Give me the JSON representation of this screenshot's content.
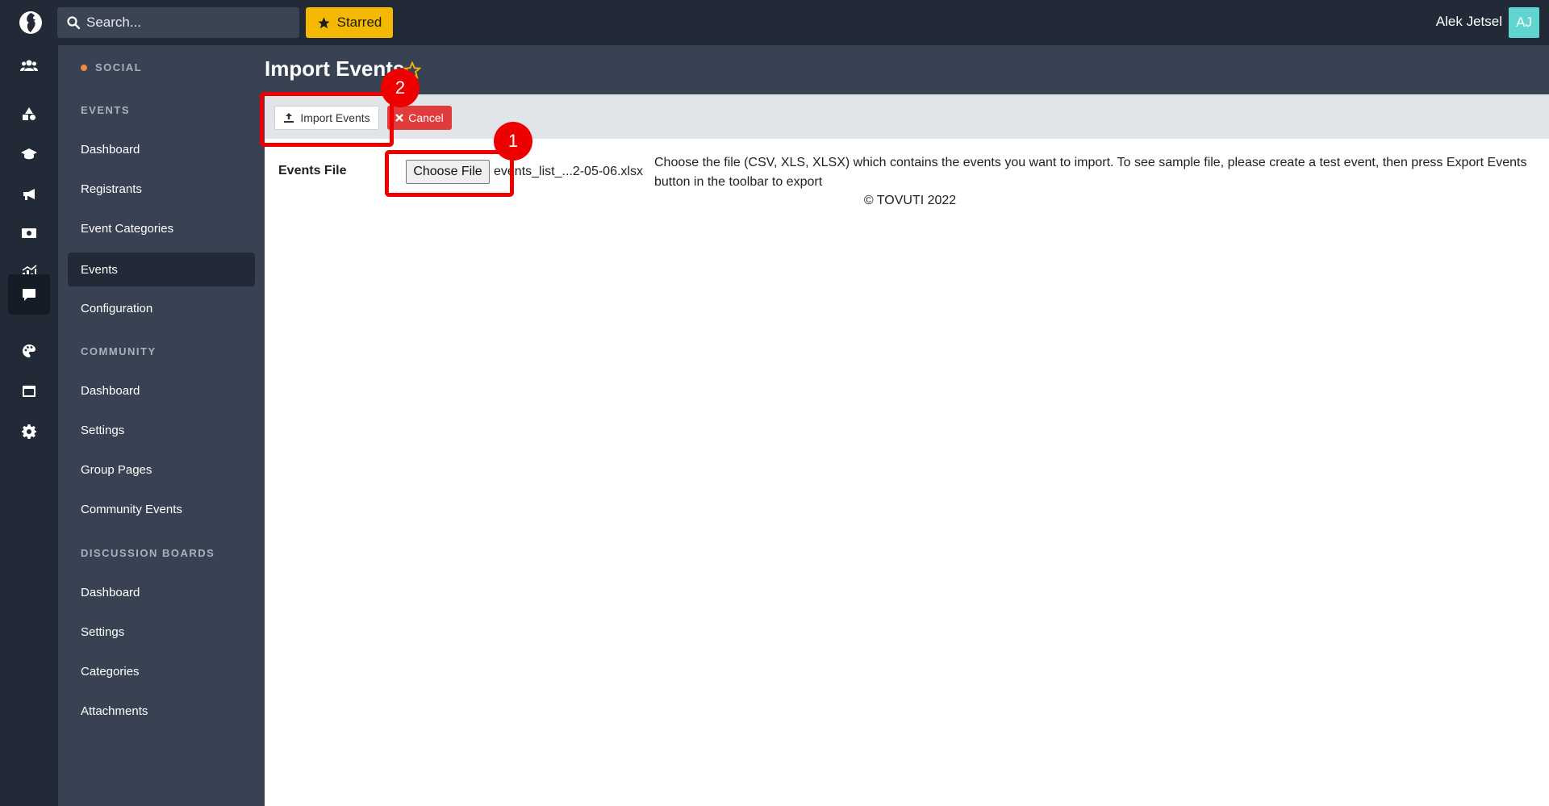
{
  "topbar": {
    "search_placeholder": "Search...",
    "starred_label": "Starred",
    "user_name": "Alek Jetsel",
    "avatar_initials": "AJ"
  },
  "rail": {
    "icons": [
      "users-icon",
      "shapes-icon",
      "graduation-cap-icon",
      "megaphone-icon",
      "money-icon",
      "chart-icon",
      "chat-icon",
      "palette-icon",
      "window-icon",
      "gear-icon"
    ],
    "active_index": 6
  },
  "sidebar": {
    "social_label": "SOCIAL",
    "sections": [
      {
        "title": "EVENTS",
        "items": [
          "Dashboard",
          "Registrants",
          "Event Categories",
          "Events",
          "Configuration"
        ]
      },
      {
        "title": "COMMUNITY",
        "items": [
          "Dashboard",
          "Settings",
          "Group Pages",
          "Community Events"
        ]
      },
      {
        "title": "DISCUSSION BOARDS",
        "items": [
          "Dashboard",
          "Settings",
          "Categories",
          "Attachments"
        ]
      }
    ],
    "active_item": "Events"
  },
  "page": {
    "title": "Import Events"
  },
  "toolbar": {
    "import_label": "Import Events",
    "cancel_label": "Cancel"
  },
  "form": {
    "label": "Events File",
    "choose_file_label": "Choose File",
    "file_name": "events_list_...2-05-06.xlsx",
    "help_text": "Choose the file (CSV, XLS, XLSX) which contains the events you want to import. To see sample file, please create a test event, then press Export Events button in the toolbar to export"
  },
  "footer": {
    "text": "© TOVUTI 2022"
  },
  "annotations": {
    "badge_1": "1",
    "badge_2": "2",
    "color": "#ee0000"
  },
  "colors": {
    "topbar_bg": "#222a37",
    "sidebar_bg": "#394252",
    "starred_bg": "#f5b800",
    "cancel_bg": "#e03c3c",
    "avatar_bg": "#5fd4d0",
    "social_dot": "#f08a3c"
  }
}
